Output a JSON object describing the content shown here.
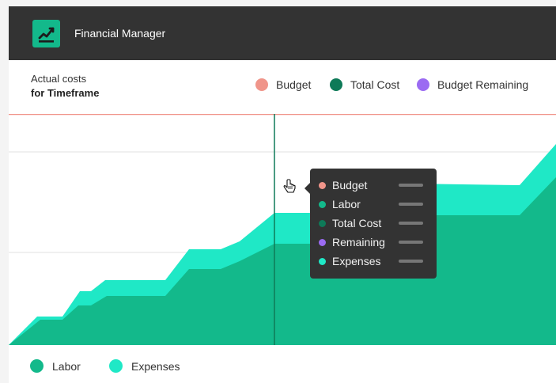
{
  "app": {
    "title": "Financial Manager",
    "logo_icon": "trend-chart-icon"
  },
  "header": {
    "caption_line1": "Actual costs",
    "caption_line2": "for Timeframe"
  },
  "legend_top": [
    {
      "label": "Budget",
      "color": "#f0958a"
    },
    {
      "label": "Total Cost",
      "color": "#0e7a58"
    },
    {
      "label": "Budget Remaining",
      "color": "#9b6bf2"
    }
  ],
  "legend_bottom": [
    {
      "label": "Labor",
      "color": "#13b98b"
    },
    {
      "label": "Expenses",
      "color": "#1fe8c6"
    }
  ],
  "tooltip": {
    "rows": [
      {
        "label": "Budget",
        "color": "#f0958a"
      },
      {
        "label": "Labor",
        "color": "#13b98b"
      },
      {
        "label": "Total Cost",
        "color": "#0e7a58"
      },
      {
        "label": "Remaining",
        "color": "#9b6bf2"
      },
      {
        "label": "Expenses",
        "color": "#1fe8c6"
      }
    ]
  },
  "chart_data": {
    "type": "area",
    "stacked": true,
    "x": [
      0,
      1,
      2,
      3,
      4,
      5,
      6,
      7,
      8,
      9,
      10,
      11,
      12,
      13,
      14,
      15,
      16,
      17,
      18
    ],
    "series": [
      {
        "name": "Labor",
        "color": "#13b98b",
        "values": [
          0,
          1.1,
          1.1,
          1.5,
          1.5,
          2.0,
          2.0,
          2.0,
          2.5,
          3.3,
          3.3,
          4.5,
          4.5,
          4.5,
          4.5,
          5.6,
          5.6,
          5.6,
          7.4
        ]
      },
      {
        "name": "Expenses",
        "color": "#1fe8c6",
        "values": [
          0,
          0.2,
          0.2,
          0.3,
          0.3,
          0.3,
          0.3,
          0.3,
          0.5,
          0.5,
          0.5,
          0.8,
          0.8,
          0.8,
          0.8,
          0.8,
          0.8,
          0.8,
          0.9
        ]
      }
    ],
    "budget_line": 10,
    "ylim": [
      0,
      10
    ],
    "cursor_x": 9,
    "grid": true
  },
  "cursor_icon": "hand-pointer-icon"
}
